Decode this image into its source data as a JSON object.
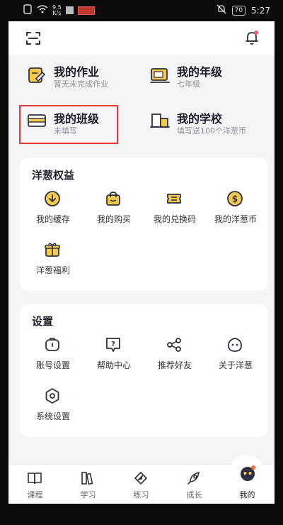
{
  "status_bar": {
    "speed_top": "9.5",
    "speed_bottom": "K/s",
    "battery": "70",
    "time": "5:27"
  },
  "cards": [
    {
      "title": "我的作业",
      "subtitle": "暂无未完成作业",
      "icon": "homework-icon"
    },
    {
      "title": "我的年级",
      "subtitle": "七年级",
      "icon": "grade-icon"
    },
    {
      "title": "我的班级",
      "subtitle": "未填写",
      "icon": "class-icon"
    },
    {
      "title": "我的学校",
      "subtitle": "填写送100个洋葱币",
      "icon": "school-icon"
    }
  ],
  "benefits": {
    "title": "洋葱权益",
    "items": [
      {
        "label": "我的缓存",
        "icon": "download-icon"
      },
      {
        "label": "我的购买",
        "icon": "shopping-bag-icon"
      },
      {
        "label": "我的兑换码",
        "icon": "ticket-icon"
      },
      {
        "label": "我的洋葱币",
        "icon": "coin-icon"
      },
      {
        "label": "洋葱福利",
        "icon": "gift-icon"
      }
    ]
  },
  "settings": {
    "title": "设置",
    "items": [
      {
        "label": "账号设置",
        "icon": "account-icon"
      },
      {
        "label": "帮助中心",
        "icon": "help-icon"
      },
      {
        "label": "推荐好友",
        "icon": "share-icon"
      },
      {
        "label": "关于洋葱",
        "icon": "onion-face-icon"
      },
      {
        "label": "系统设置",
        "icon": "hexagon-settings-icon"
      }
    ]
  },
  "tabs": [
    {
      "label": "课程",
      "icon": "book-icon"
    },
    {
      "label": "学习",
      "icon": "books-icon"
    },
    {
      "label": "练习",
      "icon": "compass-icon"
    },
    {
      "label": "成长",
      "icon": "rocket-icon"
    },
    {
      "label": "我的",
      "icon": "profile-icon"
    }
  ],
  "colors": {
    "accent_yellow": "#f7c948",
    "icon_stroke": "#2b3140",
    "highlight_red": "#e53935"
  }
}
